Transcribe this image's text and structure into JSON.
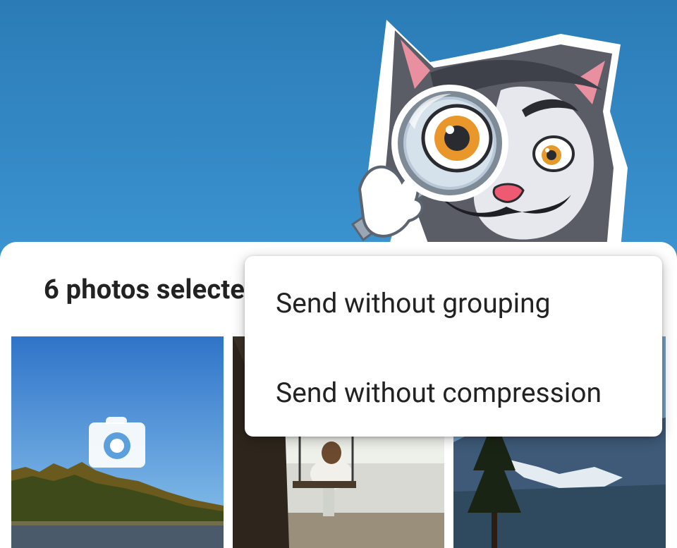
{
  "sheet": {
    "title": "6 photos selected"
  },
  "menu": {
    "items": [
      {
        "label": "Send without grouping"
      },
      {
        "label": "Send without compression"
      }
    ]
  },
  "colors": {
    "chat_background": "#2b7cb6",
    "sheet_background": "#ffffff",
    "camera_lens": "#5b9fdd"
  },
  "icons": {
    "camera": "camera-icon",
    "sticker": "detective-cat-sticker"
  }
}
